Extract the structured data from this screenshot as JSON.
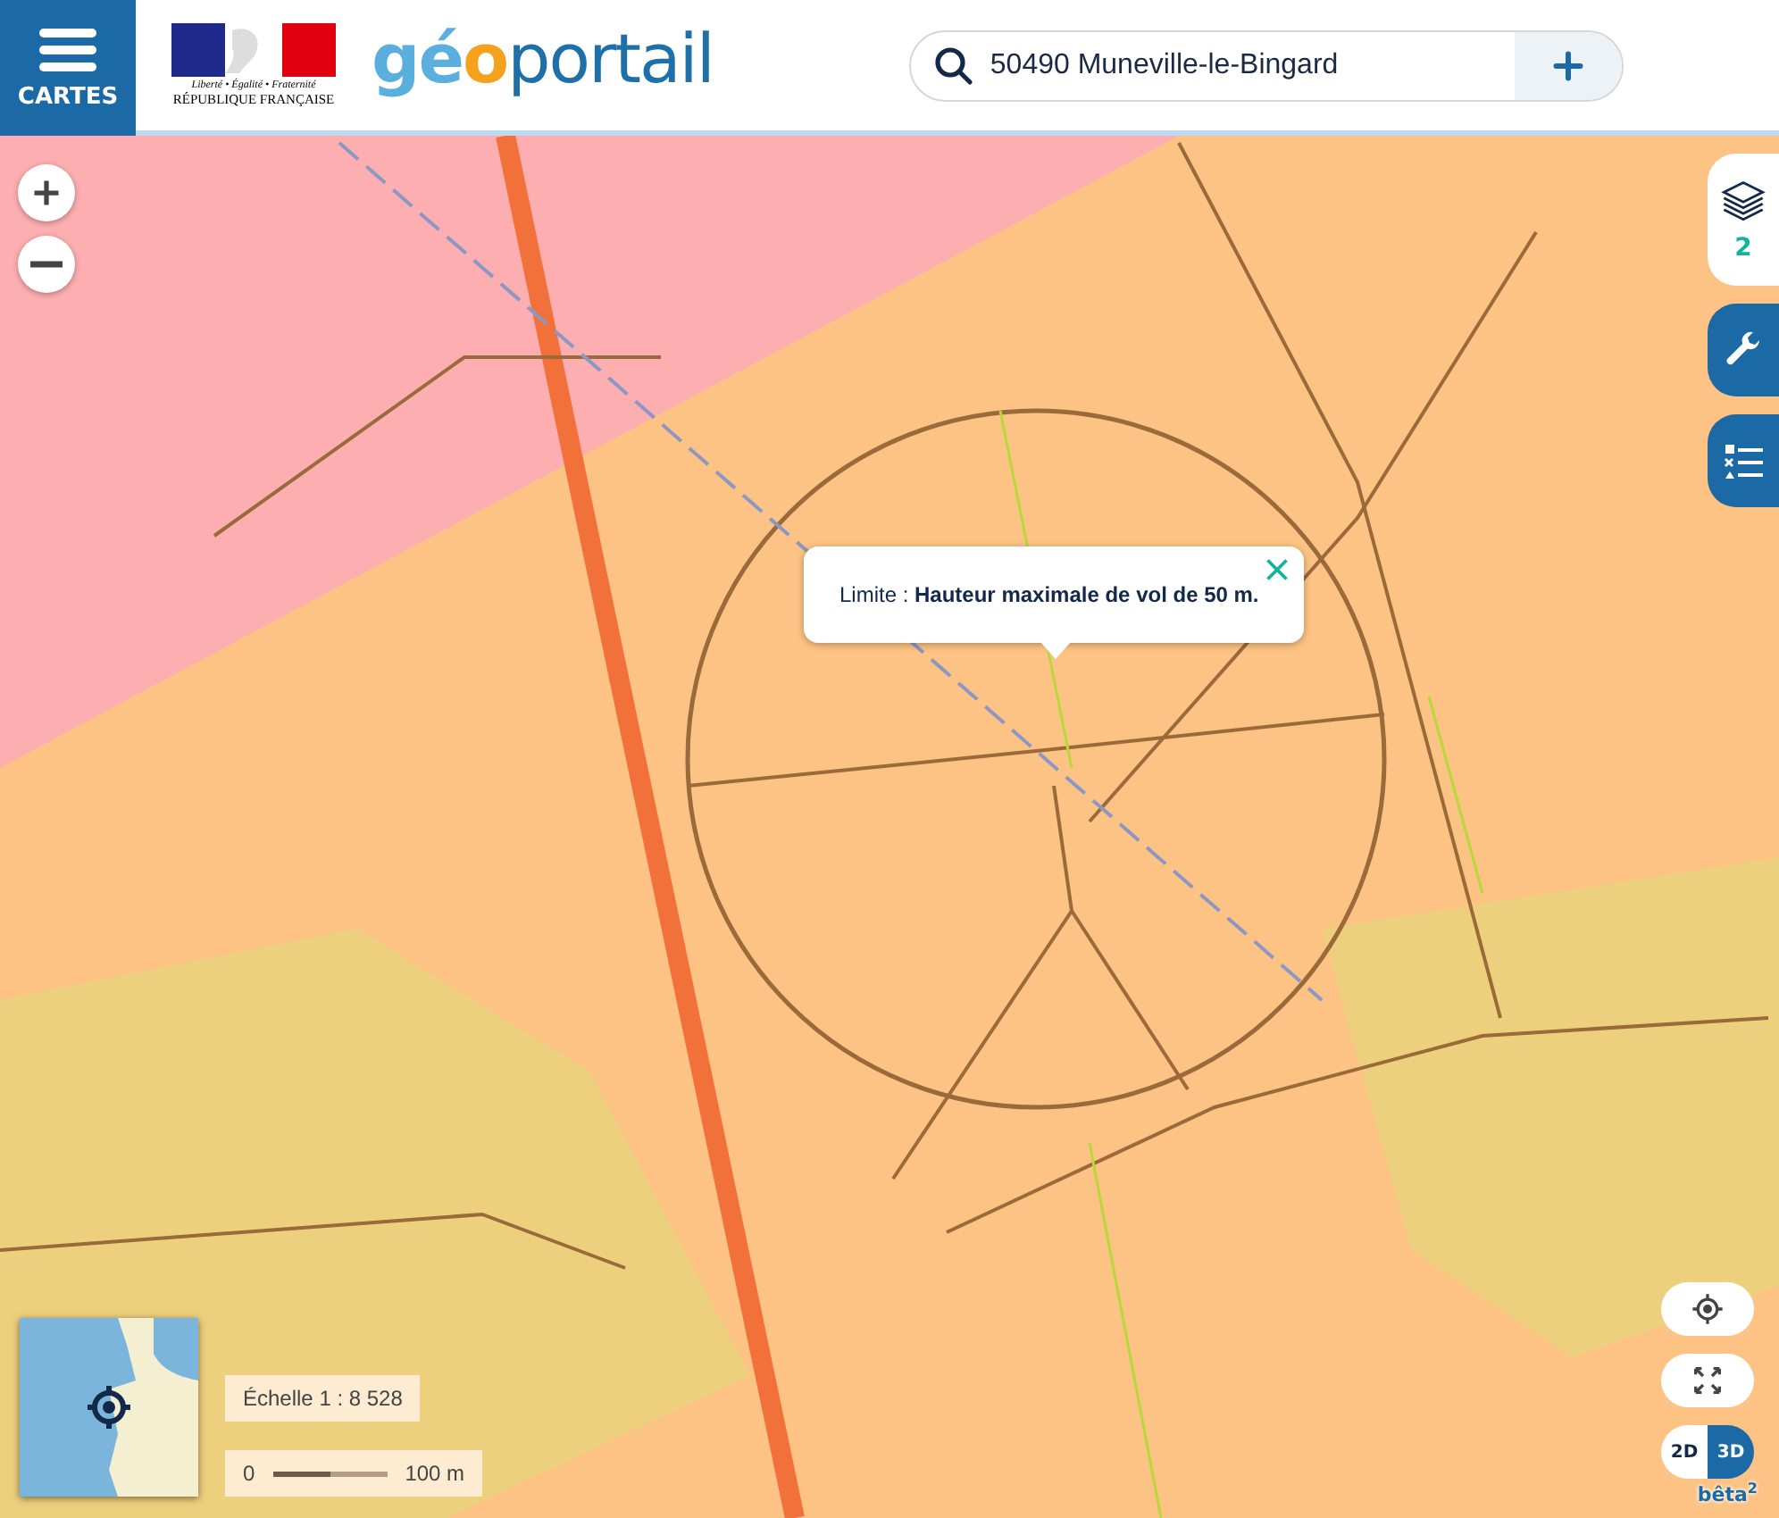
{
  "header": {
    "menu_label": "CARTES",
    "republic": {
      "motto": "Liberté • Égalité • Fraternité",
      "name": "RÉPUBLIQUE FRANÇAISE"
    },
    "logo": [
      {
        "text": "gé",
        "color": "#5aafdf"
      },
      {
        "text": "o",
        "color": "#f4a21d"
      },
      {
        "text": "portail",
        "color": "#1f6fa8"
      }
    ],
    "search": {
      "value": "50490 Muneville-le-Bingard"
    }
  },
  "popup": {
    "text": "Limite : **Hauteur maximale de vol de 50 m.**"
  },
  "side_tools": [
    {
      "kind": "layers",
      "count": "2",
      "selected": true
    },
    {
      "kind": "tools",
      "selected": false
    },
    {
      "kind": "legend",
      "selected": false
    }
  ],
  "scale": {
    "label": "Échelle 1 : 8 528",
    "start": "0",
    "end": "100 m"
  },
  "view_toggle": [
    {
      "label": "2D",
      "selected": false
    },
    {
      "label": "3D",
      "selected": true
    }
  ],
  "beta": "bêta$^{2}$"
}
